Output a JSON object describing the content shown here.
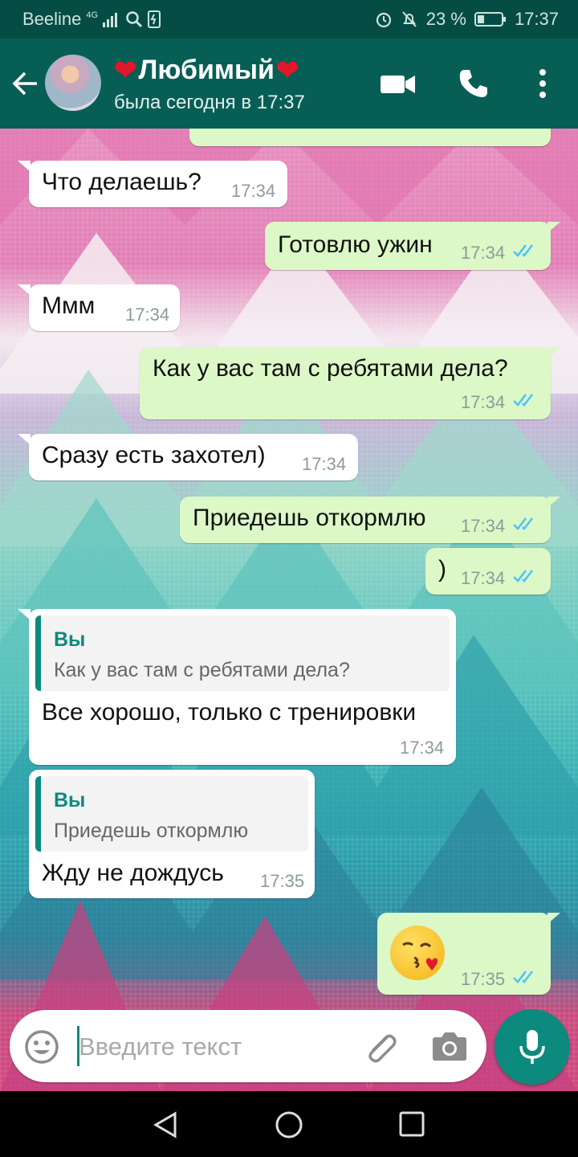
{
  "status_bar": {
    "carrier": "Beeline",
    "network": "4G",
    "battery": "23 %",
    "time": "17:37"
  },
  "header": {
    "contact_name": "Любимый",
    "last_seen": "была сегодня в 17:37"
  },
  "messages": [
    {
      "text": "Что делаешь?",
      "time": "17:34",
      "direction": "in"
    },
    {
      "text": "Готовлю ужин",
      "time": "17:34",
      "direction": "out",
      "read": true
    },
    {
      "text": "Ммм",
      "time": "17:34",
      "direction": "in"
    },
    {
      "text": "Как у вас там с ребятами дела?",
      "time": "17:34",
      "direction": "out",
      "read": true
    },
    {
      "text": "Сразу есть захотел)",
      "time": "17:34",
      "direction": "in"
    },
    {
      "text": "Приедешь откормлю",
      "time": "17:34",
      "direction": "out",
      "read": true
    },
    {
      "text": ")",
      "time": "17:34",
      "direction": "out",
      "read": true
    },
    {
      "quote_author": "Вы",
      "quote_text": "Как у вас там с ребятами дела?",
      "text": "Все хорошо, только с тренировки",
      "time": "17:34",
      "direction": "in"
    },
    {
      "quote_author": "Вы",
      "quote_text": "Приедешь откормлю",
      "text": "Жду не дождусь",
      "time": "17:35",
      "direction": "in"
    },
    {
      "emoji": "kissing-face-with-heart",
      "time": "17:35",
      "direction": "out",
      "read": true
    }
  ],
  "input": {
    "placeholder": "Введите текст"
  },
  "colors": {
    "header": "#075e54",
    "status_bar": "#054d44",
    "outgoing_bubble": "#dcf8c6",
    "incoming_bubble": "#ffffff",
    "accent": "#0c8a7d",
    "read_ticks": "#4fc3f7"
  },
  "icons": [
    "back-arrow-icon",
    "video-call-icon",
    "phone-icon",
    "more-vert-icon",
    "emoji-icon",
    "attach-icon",
    "camera-icon",
    "mic-icon",
    "nav-back-icon",
    "nav-home-icon",
    "nav-recents-icon"
  ]
}
